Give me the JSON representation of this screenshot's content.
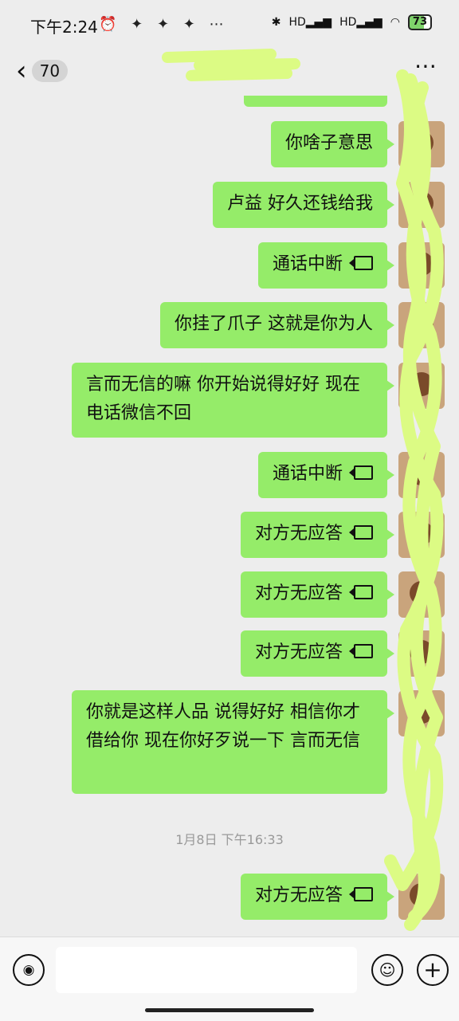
{
  "status_bar": {
    "time": "下午2:24",
    "icons_left": [
      "alarm-icon",
      "app-notification-icon",
      "app-notification-icon",
      "app-notification-icon",
      "more-notifications-icon"
    ],
    "icons_right": [
      "bluetooth-icon",
      "hd-signal-icon",
      "hd-signal-icon",
      "wifi-icon"
    ],
    "signal_label_1": "HD",
    "signal_label_2": "HD",
    "battery_level": "73"
  },
  "header": {
    "unread_count": "70",
    "title": "",
    "more_icon": "more-icon"
  },
  "messages": [
    {
      "text": "你啥子意思",
      "type": "text"
    },
    {
      "text": "卢益  好久还钱给我",
      "type": "text"
    },
    {
      "text": "通话中断",
      "type": "call"
    },
    {
      "text": "你挂了爪子  这就是你为人",
      "type": "text"
    },
    {
      "text": "言而无信的嘛  你开始说得好好  现在电话微信不回",
      "type": "text"
    },
    {
      "text": "通话中断",
      "type": "call"
    },
    {
      "text": "对方无应答",
      "type": "call"
    },
    {
      "text": "对方无应答",
      "type": "call"
    },
    {
      "text": "对方无应答",
      "type": "call"
    },
    {
      "text": "你就是这样人品  说得好好  相信你才借给你  现在你好歹说一下  言而无信",
      "type": "text"
    },
    {
      "text": "对方无应答",
      "type": "call"
    }
  ],
  "timestamp": "1月8日 下午16:33",
  "input_bar": {
    "voice_icon": "voice-icon",
    "emoji_icon": "emoji-icon",
    "plus_icon": "plus-icon",
    "input_value": ""
  },
  "colors": {
    "bubble": "#95ec69",
    "background": "#ededed",
    "scribble": "#dcfb84"
  }
}
